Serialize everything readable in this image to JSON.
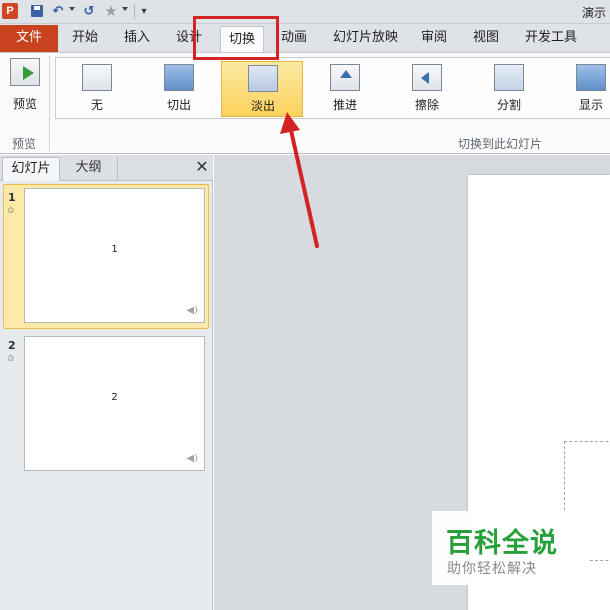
{
  "titlebar": {
    "app_icon": "P",
    "doc_title": "演示",
    "qat": {
      "save_icon": "save-icon",
      "undo_icon": "↶",
      "redo_icon": "↺",
      "star_icon": "★",
      "customize_icon": "▾"
    }
  },
  "tabs": {
    "file": "文件",
    "home": "开始",
    "insert": "插入",
    "design": "设计",
    "transitions": "切换",
    "animations": "动画",
    "slideshow": "幻灯片放映",
    "review": "审阅",
    "view": "视图",
    "developer": "开发工具"
  },
  "ribbon": {
    "preview_label": "预览",
    "preview_group_label": "预览",
    "transition_group_label": "切换到此幻灯片",
    "items": [
      {
        "label": "无",
        "icon": "none-transition-icon"
      },
      {
        "label": "切出",
        "icon": "cut-transition-icon"
      },
      {
        "label": "淡出",
        "icon": "fade-transition-icon",
        "selected": true
      },
      {
        "label": "推进",
        "icon": "push-transition-icon"
      },
      {
        "label": "擦除",
        "icon": "wipe-transition-icon"
      },
      {
        "label": "分割",
        "icon": "split-transition-icon"
      },
      {
        "label": "显示",
        "icon": "reveal-transition-icon"
      }
    ]
  },
  "left_panel": {
    "tab_slides": "幻灯片",
    "tab_outline": "大纲",
    "close_icon": "✕",
    "slides": [
      {
        "number": "1",
        "text": "1",
        "star": "✩"
      },
      {
        "number": "2",
        "text": "2",
        "star": "✩"
      }
    ]
  },
  "watermark": {
    "title": "百科全说",
    "subtitle": "助你轻松解决"
  },
  "colors": {
    "file_tab": "#c9421e",
    "selected_item": "#fbd25c",
    "annotation": "#d32424",
    "watermark_green": "#28a03a"
  }
}
